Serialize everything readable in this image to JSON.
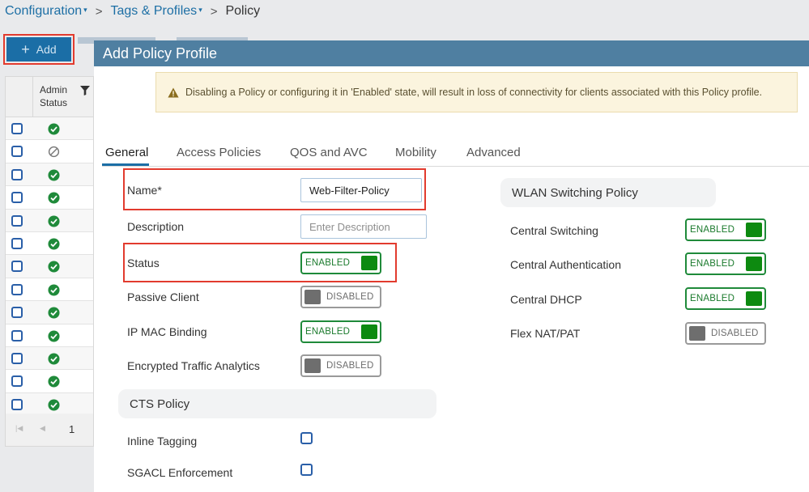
{
  "breadcrumb": {
    "items": [
      {
        "label": "Configuration",
        "has_menu": true
      },
      {
        "label": "Tags & Profiles",
        "has_menu": true
      },
      {
        "label": "Policy",
        "has_menu": false
      }
    ],
    "separator": ">",
    "caret": "▾"
  },
  "toolbar": {
    "add_label": "Add",
    "add_icon": "plus-icon",
    "plus_glyph": "+"
  },
  "background_table": {
    "column_header": "Admin\nStatus",
    "filter_icon": "filter-icon",
    "rows": [
      "enabled",
      "disabled",
      "enabled",
      "enabled",
      "enabled",
      "enabled",
      "enabled",
      "enabled",
      "enabled",
      "enabled",
      "enabled",
      "enabled",
      "enabled"
    ],
    "pager": {
      "first_glyph": "|◀",
      "prev_glyph": "◀",
      "page": "1"
    }
  },
  "modal": {
    "title": "Add Policy Profile",
    "warning": {
      "icon": "warning-icon",
      "text": "Disabling a Policy or configuring it in 'Enabled' state, will result in loss of connectivity for clients associated with this Policy profile."
    },
    "tabs": [
      {
        "label": "General",
        "active": true
      },
      {
        "label": "Access Policies",
        "active": false
      },
      {
        "label": "QOS and AVC",
        "active": false
      },
      {
        "label": "Mobility",
        "active": false
      },
      {
        "label": "Advanced",
        "active": false
      }
    ],
    "general": {
      "name_label": "Name*",
      "name_value": "Web-Filter-Policy",
      "description_label": "Description",
      "description_placeholder": "Enter Description",
      "status_label": "Status",
      "status_toggle": "ENABLED",
      "passive_client_label": "Passive Client",
      "passive_client_toggle": "DISABLED",
      "ip_mac_binding_label": "IP MAC Binding",
      "ip_mac_binding_toggle": "ENABLED",
      "encrypted_traffic_label": "Encrypted Traffic Analytics",
      "encrypted_traffic_toggle": "DISABLED",
      "cts_policy_title": "CTS Policy",
      "inline_tagging_label": "Inline Tagging",
      "inline_tagging_checked": false,
      "sgacl_label": "SGACL Enforcement",
      "sgacl_checked": false
    },
    "wlan_switching": {
      "title": "WLAN Switching Policy",
      "central_switching_label": "Central Switching",
      "central_switching_toggle": "ENABLED",
      "central_auth_label": "Central Authentication",
      "central_auth_toggle": "ENABLED",
      "central_dhcp_label": "Central DHCP",
      "central_dhcp_toggle": "ENABLED",
      "flex_nat_label": "Flex NAT/PAT",
      "flex_nat_toggle": "DISABLED"
    }
  },
  "colors": {
    "brand_blue": "#1b6ea6",
    "header_blue": "#4f7fa1",
    "enabled_green": "#0d8a10",
    "highlight_red": "#e23b2e",
    "warning_bg": "#fbf4de"
  }
}
